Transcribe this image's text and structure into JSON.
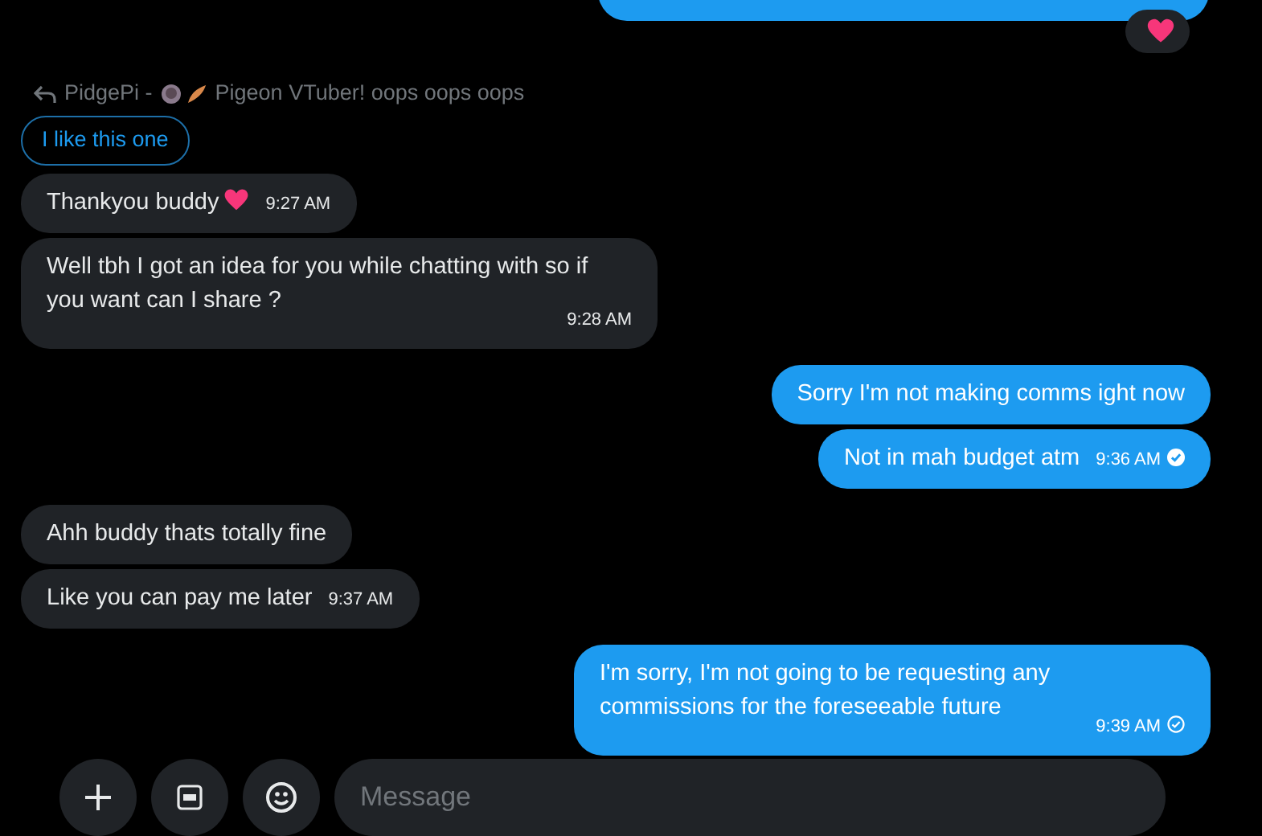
{
  "top_message": {
    "reacted": true
  },
  "reply": {
    "name": "PidgePi -",
    "description": "Pigeon VTuber! oops oops oops",
    "quote": "I like this one"
  },
  "messages": [
    {
      "kind": "received",
      "text": "Thankyou buddy",
      "heart": true,
      "time": "9:27 AM"
    },
    {
      "kind": "received",
      "text": "Well tbh I got an idea for you while chatting with so if you want can I share ?",
      "heart": false,
      "time": "9:28 AM"
    },
    {
      "kind": "sent",
      "text": "Sorry  I'm not making comms ight now",
      "heart": false
    },
    {
      "kind": "sent",
      "text": "Not in mah budget atm",
      "heart": false,
      "time": "9:36 AM",
      "read": true
    },
    {
      "kind": "received",
      "text": "Ahh buddy thats totally fine",
      "heart": false
    },
    {
      "kind": "received",
      "text": "Like you can pay me later",
      "heart": false,
      "time": "9:37 AM"
    },
    {
      "kind": "sent",
      "text": "I'm sorry, I'm not going to be requesting any commissions for the foreseeable future",
      "heart": false,
      "time": "9:39 AM",
      "read": false
    }
  ],
  "composer": {
    "placeholder": "Message"
  }
}
